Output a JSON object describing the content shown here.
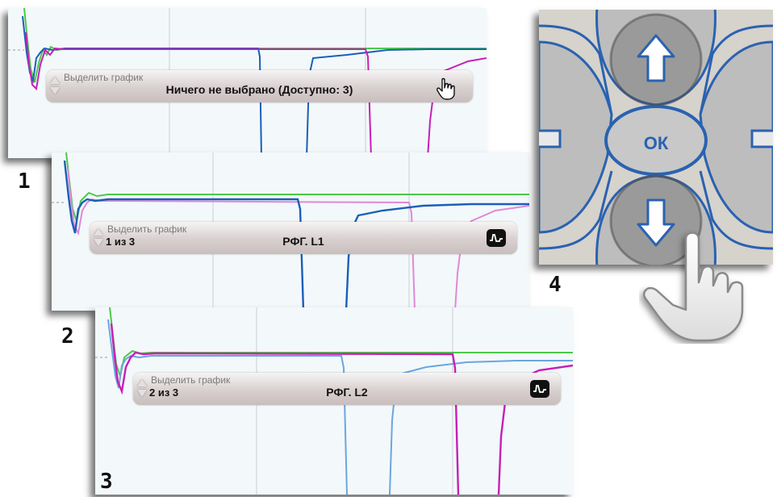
{
  "colors": {
    "green": "#4cc84c",
    "blue": "#1a5fb8",
    "magenta": "#c71fb7",
    "light_blue": "#6aa6e0",
    "keypad_blue": "#2a62b0"
  },
  "panels": [
    {
      "number": "1",
      "selector": {
        "label": "Выделить график",
        "counter": "",
        "value": "Ничего не выбрано (Доступно: 3)",
        "icon": "hand-pointer-icon"
      }
    },
    {
      "number": "2",
      "selector": {
        "label": "Выделить график",
        "counter": "1 из 3",
        "value": "РФГ. L1",
        "icon": "graph-waveform-icon"
      }
    },
    {
      "number": "3",
      "selector": {
        "label": "Выделить график",
        "counter": "2 из 3",
        "value": "РФГ. L2",
        "icon": "graph-waveform-icon"
      }
    }
  ],
  "keypad": {
    "number": "4",
    "ok_label": "ОК",
    "up_icon": "arrow-up-icon",
    "down_icon": "arrow-down-icon",
    "hand_icon": "hand-pressing-icon"
  }
}
